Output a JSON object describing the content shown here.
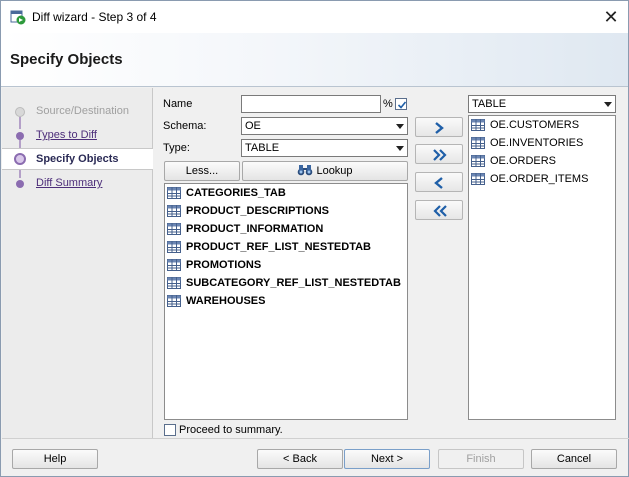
{
  "window": {
    "title": "Diff wizard - Step 3 of 4",
    "close_glyph": "✕"
  },
  "header": {
    "title": "Specify Objects"
  },
  "steps": [
    {
      "label": "Source/Destination",
      "state": "disabled"
    },
    {
      "label": "Types to Diff",
      "state": "link"
    },
    {
      "label": "Specify Objects",
      "state": "active"
    },
    {
      "label": "Diff Summary",
      "state": "link"
    }
  ],
  "form": {
    "name_label": "Name",
    "name_value": "",
    "percent_label": "%",
    "percent_checked": true,
    "schema_label": "Schema:",
    "schema_value": "OE",
    "type_label": "Type:",
    "type_value": "TABLE",
    "less_label": "Less...",
    "lookup_label": "Lookup",
    "proceed_label": "Proceed to summary.",
    "proceed_checked": false
  },
  "available_objects": [
    "CATEGORIES_TAB",
    "PRODUCT_DESCRIPTIONS",
    "PRODUCT_INFORMATION",
    "PRODUCT_REF_LIST_NESTEDTAB",
    "PROMOTIONS",
    "SUBCATEGORY_REF_LIST_NESTEDTAB",
    "WAREHOUSES"
  ],
  "selected_panel": {
    "filter_value": "TABLE",
    "items": [
      "OE.CUSTOMERS",
      "OE.INVENTORIES",
      "OE.ORDERS",
      "OE.ORDER_ITEMS"
    ]
  },
  "move_buttons": [
    "move-right",
    "move-all-right",
    "move-left",
    "move-all-left"
  ],
  "footer": {
    "help_label": "Help",
    "back_label": "< Back",
    "next_label": "Next >",
    "finish_label": "Finish",
    "cancel_label": "Cancel"
  },
  "colors": {
    "accent": "#1f5fa8",
    "step_link": "#4d2e7a",
    "step_active": "#2a2a55"
  },
  "icons": {
    "app": "diff-wizard-icon",
    "table": "table-icon",
    "lookup": "binoculars-icon"
  }
}
